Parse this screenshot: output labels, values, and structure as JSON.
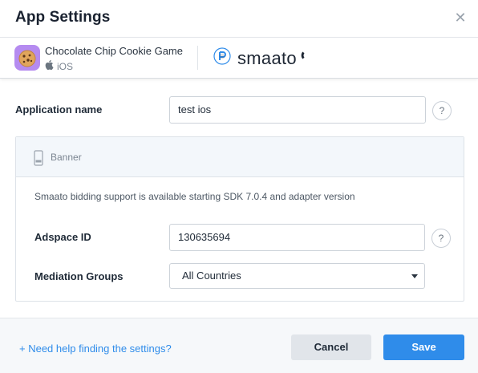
{
  "dialog": {
    "title": "App Settings"
  },
  "app": {
    "name": "Chocolate Chip Cookie Game",
    "platform": "iOS",
    "network_name": "smaato"
  },
  "form": {
    "application_name_label": "Application name",
    "application_name_value": "test ios",
    "help_glyph": "?"
  },
  "ad_unit": {
    "type_label": "Banner",
    "note": "Smaato bidding support is available starting SDK 7.0.4 and adapter version",
    "adspace_label": "Adspace ID",
    "adspace_value": "130635694",
    "mediation_label": "Mediation Groups",
    "mediation_selected": "All Countries"
  },
  "footer": {
    "help_link": "+ Need help finding the settings?",
    "cancel_label": "Cancel",
    "save_label": "Save"
  },
  "icons": {
    "close": "close-icon",
    "apple": "apple-icon",
    "network_logo": "smaato-logo-icon",
    "banner": "phone-banner-icon",
    "dropdown": "chevron-down-icon"
  },
  "colors": {
    "accent": "#2f8cea",
    "app_icon_bg": "#b58bf0",
    "panel_header_bg": "#f3f7fb",
    "footer_bg": "#f6f8fa",
    "cancel_bg": "#e1e5ea"
  }
}
